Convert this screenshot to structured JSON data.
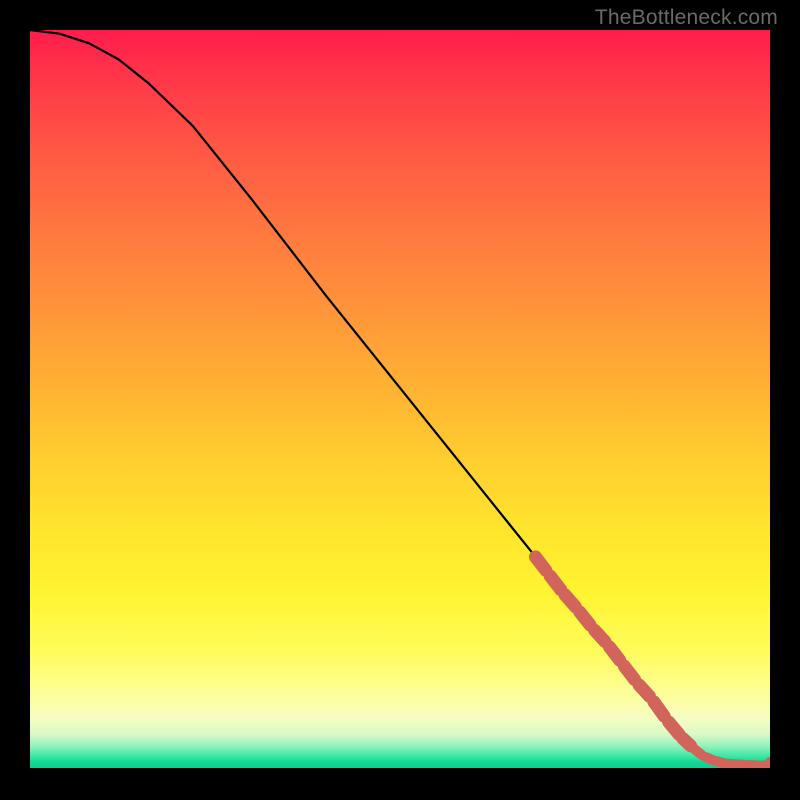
{
  "attribution": "TheBottleneck.com",
  "colors": {
    "line": "#000000",
    "marker": "#d1655b",
    "background_black": "#000000"
  },
  "chart_data": {
    "type": "line",
    "title": "",
    "xlabel": "",
    "ylabel": "",
    "xlim": [
      0,
      100
    ],
    "ylim": [
      0,
      100
    ],
    "grid": false,
    "legend": false,
    "note": "No axis ticks or numeric labels are rendered; values below are pixel-derived curve coordinates in a 0–100 normalized space (y=100 top, y=0 bottom).",
    "series": [
      {
        "name": "curve",
        "style": "solid-black-line",
        "x": [
          0,
          4,
          8,
          12,
          16,
          22,
          30,
          40,
          50,
          60,
          68,
          74,
          78,
          82,
          85,
          88,
          90,
          92,
          94,
          96,
          98,
          100
        ],
        "y": [
          100,
          99.5,
          98.2,
          96,
          92.8,
          87,
          77,
          64,
          51.5,
          39,
          29,
          21.8,
          16.8,
          11.6,
          7.8,
          4.2,
          2.4,
          1.2,
          0.6,
          0.4,
          0.3,
          0.3
        ]
      },
      {
        "name": "highlight-segment",
        "style": "thick-salmon-dashed-overlay",
        "x": [
          68,
          70,
          72,
          74,
          76,
          78,
          80,
          82,
          84,
          86,
          88,
          89.5,
          91,
          92.5,
          94,
          95.5,
          97,
          98.5,
          100
        ],
        "y": [
          29,
          26.4,
          23.8,
          21.5,
          19,
          16.8,
          14.2,
          11.6,
          9.4,
          6.6,
          4.2,
          2.8,
          1.6,
          1.0,
          0.6,
          0.5,
          0.4,
          0.35,
          0.3
        ]
      }
    ]
  }
}
